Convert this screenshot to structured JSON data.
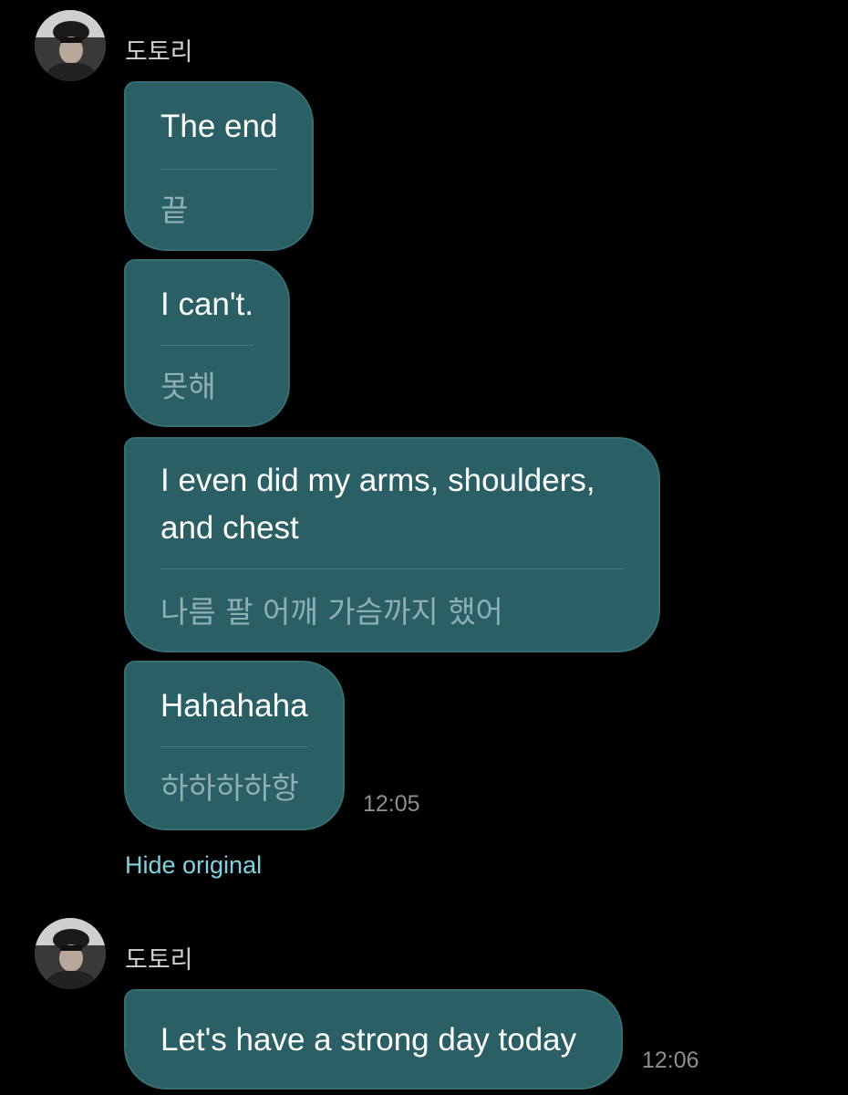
{
  "groups": [
    {
      "sender": "도토리",
      "messages": [
        {
          "text": "The end",
          "translated": "끝"
        },
        {
          "text": "I can't.",
          "translated": "못해"
        },
        {
          "text_lines": [
            "I even did my arms, shoulders,",
            "and chest"
          ],
          "translated": "나름 팔 어깨 가슴까지 했어"
        },
        {
          "text": "Hahahaha",
          "translated": "하하하하항",
          "time": "12:05"
        }
      ],
      "action_link": "Hide original"
    },
    {
      "sender": "도토리",
      "messages": [
        {
          "text": "Let's have a strong day today",
          "time": "12:06"
        }
      ]
    }
  ],
  "colors": {
    "background": "#000000",
    "bubble": "#2a6065",
    "link": "#7fd3e0",
    "time": "#8e8e8e"
  },
  "icons": [
    "avatar-photo"
  ]
}
